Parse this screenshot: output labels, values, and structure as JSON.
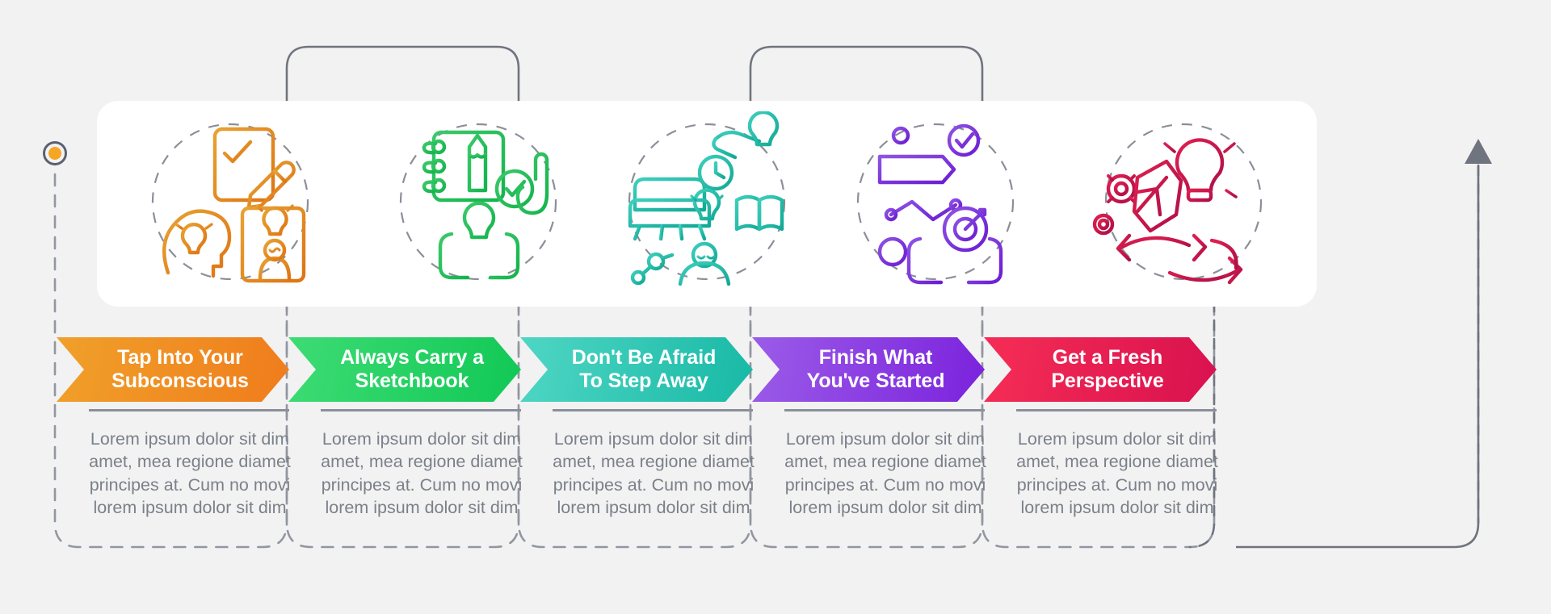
{
  "page": {
    "background": "#f2f2f2",
    "arrow_marker": "up-triangle",
    "arrow_color": "#70747f"
  },
  "steps": [
    {
      "id": "step-1",
      "index": 1,
      "title_line1": "Tap Into Your",
      "title_line2": "Subconscious",
      "body": "Lorem ipsum dolor sit dim amet, mea regione diamet principes at. Cum no movi lorem ipsum dolor sit dim",
      "color_start": "#f0a02a",
      "color_end": "#f07c1c",
      "dot_color": "#f5a623",
      "icon_color_start": "#e89a2e",
      "icon_color_end": "#e07818",
      "icon_name": "checklist-pencil-head-lightbulb-icon"
    },
    {
      "id": "step-2",
      "index": 2,
      "title_line1": "Always Carry a",
      "title_line2": "Sketchbook",
      "body": "Lorem ipsum dolor sit dim amet, mea regione diamet principes at. Cum no movi lorem ipsum dolor sit dim",
      "color_start": "#3ddc74",
      "color_end": "#11c855",
      "dot_color": "#21c95e",
      "icon_color_start": "#3cc96a",
      "icon_color_end": "#17b84e",
      "icon_name": "notebook-pencil-lightbulb-hands-icon"
    },
    {
      "id": "step-3",
      "index": 3,
      "title_line1": "Don't Be Afraid",
      "title_line2": "To Step Away",
      "body": "Lorem ipsum dolor sit dim amet, mea regione diamet principes at. Cum no movi lorem ipsum dolor sit dim",
      "color_start": "#4fd6c4",
      "color_end": "#18b9a6",
      "dot_color": "#23c8b4",
      "icon_color_start": "#3ecfbd",
      "icon_color_end": "#14ac99",
      "icon_name": "sofa-clock-lightbulb-book-icon"
    },
    {
      "id": "step-4",
      "index": 4,
      "title_line1": "Finish What",
      "title_line2": "You've Started",
      "body": "Lorem ipsum dolor sit dim amet, mea regione diamet principes at. Cum no movi lorem ipsum dolor sit dim",
      "color_start": "#9b5ce8",
      "color_end": "#7b22dd",
      "dot_color": "#7b2ee0",
      "icon_color_start": "#8f53e4",
      "icon_color_end": "#6f1fd4",
      "icon_name": "flag-target-hands-checkmark-icon"
    },
    {
      "id": "step-5",
      "index": 5,
      "title_line1": "Get a Fresh",
      "title_line2": "Perspective",
      "body": "Lorem ipsum dolor sit dim amet, mea regione diamet principes at. Cum no movi lorem ipsum dolor sit dim",
      "color_start": "#f52d55",
      "color_end": "#d9114f",
      "dot_color": "#ee1f4e",
      "icon_color_start": "#e02050",
      "icon_color_end": "#b3114a",
      "icon_name": "gears-crumpled-paper-lightbulb-arrows-icon"
    }
  ]
}
